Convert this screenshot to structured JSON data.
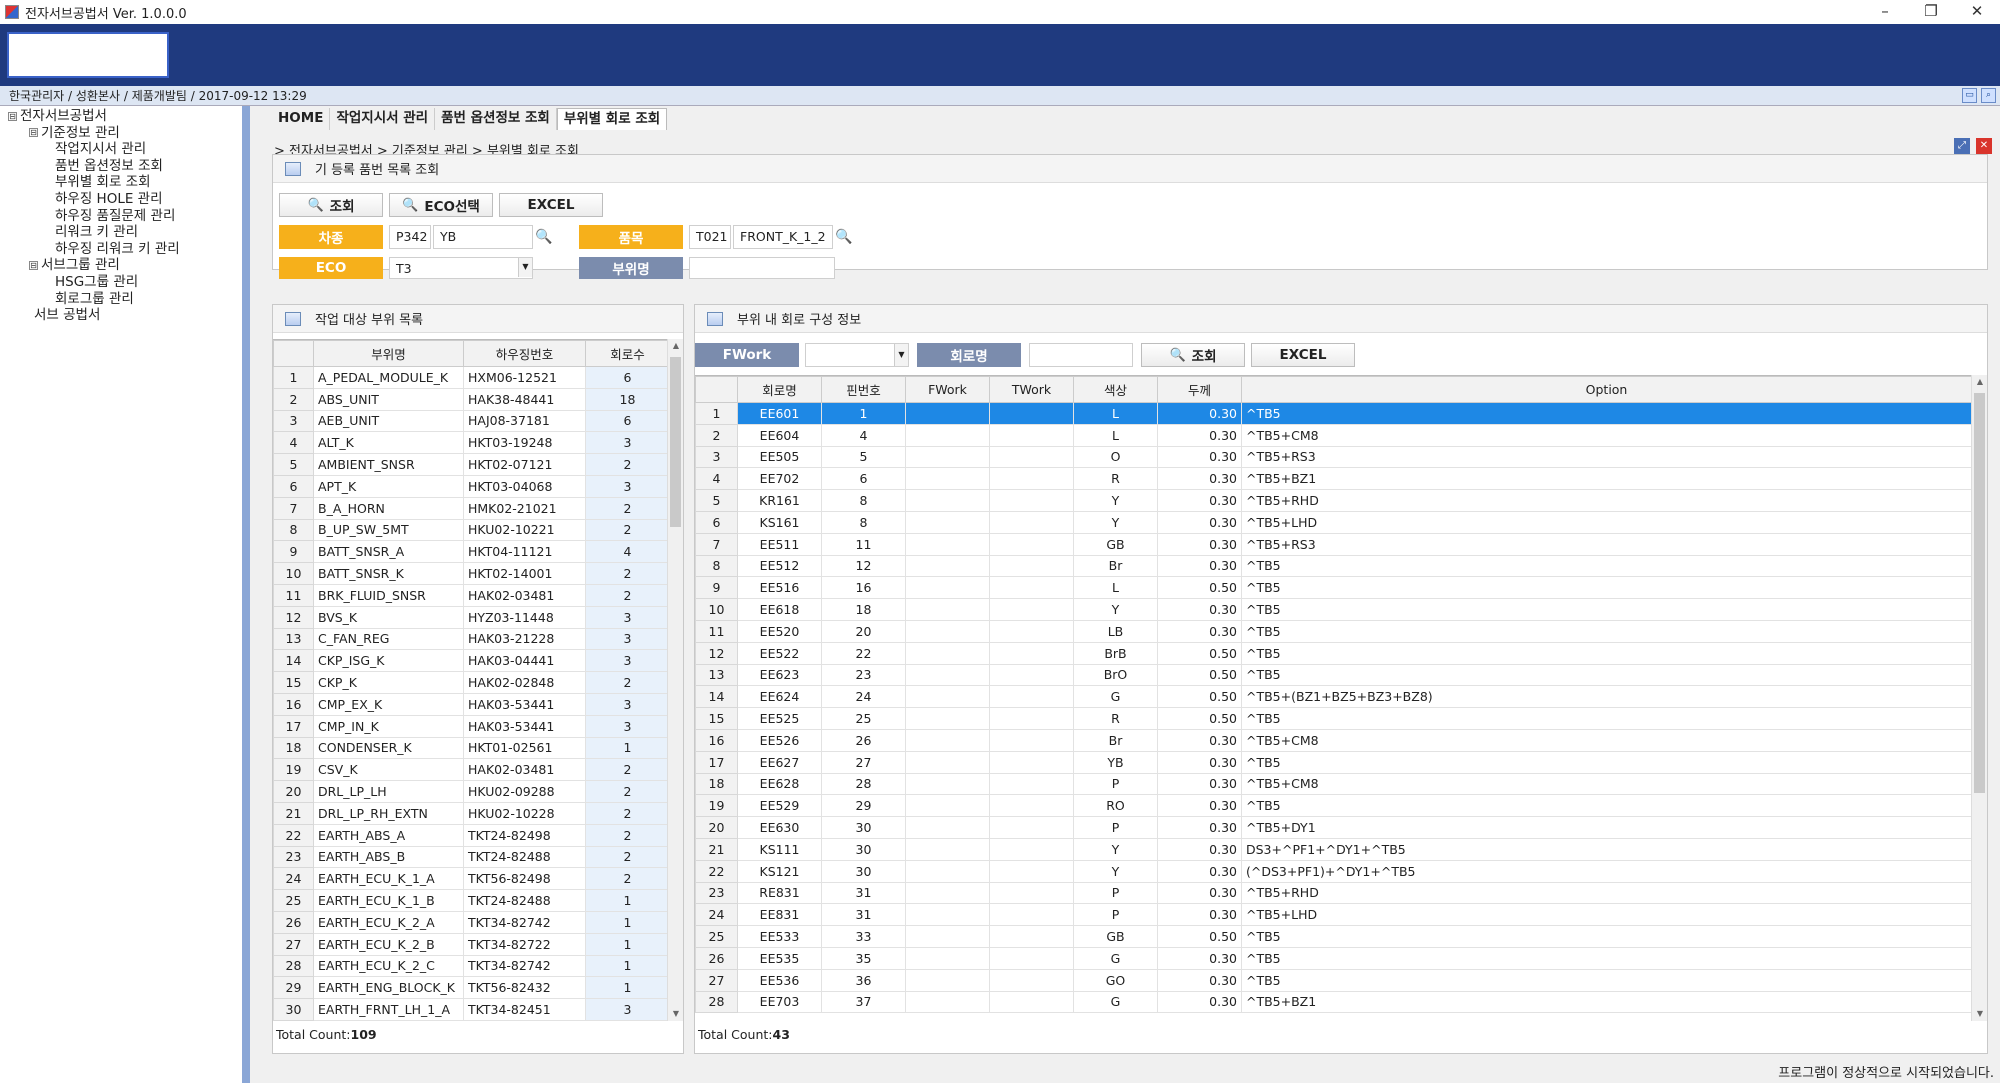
{
  "window": {
    "title": "전자서브공법서 Ver. 1.0.0.0",
    "min": "–",
    "restore": "❐",
    "close": "✕"
  },
  "info_bar": {
    "text": "한국관리자 / 성환본사 / 제품개발팀 / 2017-09-12 13:29"
  },
  "tree": [
    {
      "label": "전자서브공법서",
      "level": 0,
      "expander": "⊟"
    },
    {
      "label": "기준정보 관리",
      "level": 1,
      "expander": "⊟"
    },
    {
      "label": "작업지시서 관리",
      "level": 2
    },
    {
      "label": "품번 옵션정보 조회",
      "level": 2
    },
    {
      "label": "부위별 회로 조회",
      "level": 2
    },
    {
      "label": "하우징 HOLE 관리",
      "level": 2
    },
    {
      "label": "하우징 품질문제 관리",
      "level": 2
    },
    {
      "label": "리워크 키 관리",
      "level": 2
    },
    {
      "label": "하우징 리워크 키 관리",
      "level": 2
    },
    {
      "label": "서브그룹 관리",
      "level": 1,
      "expander": "⊟"
    },
    {
      "label": "HSG그룹 관리",
      "level": 2
    },
    {
      "label": "회로그룹 관리",
      "level": 2
    },
    {
      "label": "서브 공법서",
      "level": 1
    }
  ],
  "tabs": [
    "HOME",
    "작업지시서 관리",
    "품번 옵션정보 조회",
    "부위별 회로 조회"
  ],
  "breadcrumb": "> 전자서브공법서 > 기준정보 관리 > 부위별 회로 조회",
  "top_panel": {
    "title": "기 등록 품번 목록 조회",
    "search_btn": "조회",
    "eco_btn": "ECO선택",
    "excel_btn": "EXCEL",
    "car_label": "차종",
    "car_code": "P342",
    "car_name": "YB",
    "part_label": "품목",
    "part_code": "T021",
    "part_name": "FRONT_K_1_2",
    "eco_label": "ECO",
    "eco_value": "T3",
    "area_label": "부위명",
    "area_value": ""
  },
  "left_panel": {
    "title": "작업 대상 부위 목록",
    "columns": [
      "부위명",
      "하우징번호",
      "회로수"
    ],
    "total_label": "Total Count:",
    "total": "109",
    "rows": [
      [
        "1",
        "A_PEDAL_MODULE_K",
        "HXM06-12521",
        "6"
      ],
      [
        "2",
        "ABS_UNIT",
        "HAK38-48441",
        "18"
      ],
      [
        "3",
        "AEB_UNIT",
        "HAJ08-37181",
        "6"
      ],
      [
        "4",
        "ALT_K",
        "HKT03-19248",
        "3"
      ],
      [
        "5",
        "AMBIENT_SNSR",
        "HKT02-07121",
        "2"
      ],
      [
        "6",
        "APT_K",
        "HKT03-04068",
        "3"
      ],
      [
        "7",
        "B_A_HORN",
        "HMK02-21021",
        "2"
      ],
      [
        "8",
        "B_UP_SW_5MT",
        "HKU02-10221",
        "2"
      ],
      [
        "9",
        "BATT_SNSR_A",
        "HKT04-11121",
        "4"
      ],
      [
        "10",
        "BATT_SNSR_K",
        "HKT02-14001",
        "2"
      ],
      [
        "11",
        "BRK_FLUID_SNSR",
        "HAK02-03481",
        "2"
      ],
      [
        "12",
        "BVS_K",
        "HYZ03-11448",
        "3"
      ],
      [
        "13",
        "C_FAN_REG",
        "HAK03-21228",
        "3"
      ],
      [
        "14",
        "CKP_ISG_K",
        "HAK03-04441",
        "3"
      ],
      [
        "15",
        "CKP_K",
        "HAK02-02848",
        "2"
      ],
      [
        "16",
        "CMP_EX_K",
        "HAK03-53441",
        "3"
      ],
      [
        "17",
        "CMP_IN_K",
        "HAK03-53441",
        "3"
      ],
      [
        "18",
        "CONDENSER_K",
        "HKT01-02561",
        "1"
      ],
      [
        "19",
        "CSV_K",
        "HAK02-03481",
        "2"
      ],
      [
        "20",
        "DRL_LP_LH",
        "HKU02-09288",
        "2"
      ],
      [
        "21",
        "DRL_LP_RH_EXTN",
        "HKU02-10228",
        "2"
      ],
      [
        "22",
        "EARTH_ABS_A",
        "TKT24-82498",
        "2"
      ],
      [
        "23",
        "EARTH_ABS_B",
        "TKT24-82488",
        "2"
      ],
      [
        "24",
        "EARTH_ECU_K_1_A",
        "TKT56-82498",
        "2"
      ],
      [
        "25",
        "EARTH_ECU_K_1_B",
        "TKT24-82488",
        "1"
      ],
      [
        "26",
        "EARTH_ECU_K_2_A",
        "TKT34-82742",
        "1"
      ],
      [
        "27",
        "EARTH_ECU_K_2_B",
        "TKT34-82722",
        "1"
      ],
      [
        "28",
        "EARTH_ECU_K_2_C",
        "TKT34-82742",
        "1"
      ],
      [
        "29",
        "EARTH_ENG_BLOCK_K",
        "TKT56-82432",
        "1"
      ],
      [
        "30",
        "EARTH_FRNT_LH_1_A",
        "TKT34-82451",
        "3"
      ]
    ]
  },
  "right_panel": {
    "title": "부위 내 회로 구성 정보",
    "fwork_label": "FWork",
    "fwork_value": "",
    "circuit_label": "회로명",
    "circuit_value": "",
    "search_btn": "조회",
    "excel_btn": "EXCEL",
    "columns": [
      "회로명",
      "핀번호",
      "FWork",
      "TWork",
      "색상",
      "두께",
      "Option"
    ],
    "total_label": "Total Count:",
    "total": "43",
    "rows": [
      [
        "1",
        "EE601",
        "1",
        "",
        "",
        "L",
        "0.30",
        "^TB5"
      ],
      [
        "2",
        "EE604",
        "4",
        "",
        "",
        "L",
        "0.30",
        "^TB5+CM8"
      ],
      [
        "3",
        "EE505",
        "5",
        "",
        "",
        "O",
        "0.30",
        "^TB5+RS3"
      ],
      [
        "4",
        "EE702",
        "6",
        "",
        "",
        "R",
        "0.30",
        "^TB5+BZ1"
      ],
      [
        "5",
        "KR161",
        "8",
        "",
        "",
        "Y",
        "0.30",
        "^TB5+RHD"
      ],
      [
        "6",
        "KS161",
        "8",
        "",
        "",
        "Y",
        "0.30",
        "^TB5+LHD"
      ],
      [
        "7",
        "EE511",
        "11",
        "",
        "",
        "GB",
        "0.30",
        "^TB5+RS3"
      ],
      [
        "8",
        "EE512",
        "12",
        "",
        "",
        "Br",
        "0.30",
        "^TB5"
      ],
      [
        "9",
        "EE516",
        "16",
        "",
        "",
        "L",
        "0.50",
        "^TB5"
      ],
      [
        "10",
        "EE618",
        "18",
        "",
        "",
        "Y",
        "0.30",
        "^TB5"
      ],
      [
        "11",
        "EE520",
        "20",
        "",
        "",
        "LB",
        "0.30",
        "^TB5"
      ],
      [
        "12",
        "EE522",
        "22",
        "",
        "",
        "BrB",
        "0.50",
        "^TB5"
      ],
      [
        "13",
        "EE623",
        "23",
        "",
        "",
        "BrO",
        "0.50",
        "^TB5"
      ],
      [
        "14",
        "EE624",
        "24",
        "",
        "",
        "G",
        "0.50",
        "^TB5+(BZ1+BZ5+BZ3+BZ8)"
      ],
      [
        "15",
        "EE525",
        "25",
        "",
        "",
        "R",
        "0.50",
        "^TB5"
      ],
      [
        "16",
        "EE526",
        "26",
        "",
        "",
        "Br",
        "0.30",
        "^TB5+CM8"
      ],
      [
        "17",
        "EE627",
        "27",
        "",
        "",
        "YB",
        "0.30",
        "^TB5"
      ],
      [
        "18",
        "EE628",
        "28",
        "",
        "",
        "P",
        "0.30",
        "^TB5+CM8"
      ],
      [
        "19",
        "EE529",
        "29",
        "",
        "",
        "RO",
        "0.30",
        "^TB5"
      ],
      [
        "20",
        "EE630",
        "30",
        "",
        "",
        "P",
        "0.30",
        "^TB5+DY1"
      ],
      [
        "21",
        "KS111",
        "30",
        "",
        "",
        "Y",
        "0.30",
        "DS3+^PF1+^DY1+^TB5"
      ],
      [
        "22",
        "KS121",
        "30",
        "",
        "",
        "Y",
        "0.30",
        "(^DS3+PF1)+^DY1+^TB5"
      ],
      [
        "23",
        "RE831",
        "31",
        "",
        "",
        "P",
        "0.30",
        "^TB5+RHD"
      ],
      [
        "24",
        "EE831",
        "31",
        "",
        "",
        "P",
        "0.30",
        "^TB5+LHD"
      ],
      [
        "25",
        "EE533",
        "33",
        "",
        "",
        "GB",
        "0.50",
        "^TB5"
      ],
      [
        "26",
        "EE535",
        "35",
        "",
        "",
        "G",
        "0.30",
        "^TB5"
      ],
      [
        "27",
        "EE536",
        "36",
        "",
        "",
        "GO",
        "0.30",
        "^TB5"
      ],
      [
        "28",
        "EE703",
        "37",
        "",
        "",
        "G",
        "0.30",
        "^TB5+BZ1"
      ]
    ]
  },
  "status_bar": {
    "text": "프로그램이 정상적으로 시작되었습니다."
  },
  "icons": {
    "search": "🔍",
    "dropdown": "▼",
    "scroll_up": "▲",
    "scroll_down": "▼"
  }
}
